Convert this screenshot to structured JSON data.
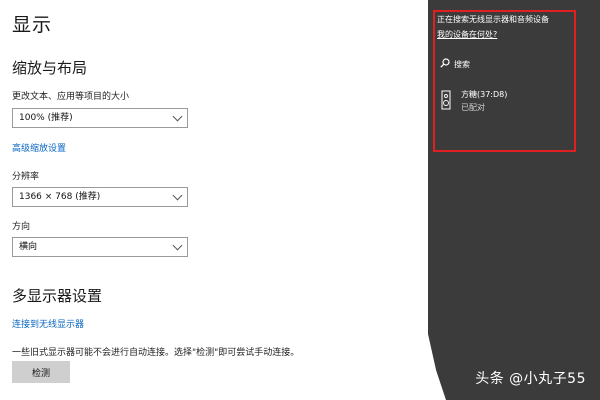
{
  "settings": {
    "title": "显示",
    "scale_layout": {
      "heading": "缩放与布局",
      "text_size_label": "更改文本、应用等项目的大小",
      "text_size_value": "100% (推荐)",
      "advanced_link": "高级缩放设置",
      "resolution_label": "分辨率",
      "resolution_value": "1366 × 768 (推荐)",
      "orientation_label": "方向",
      "orientation_value": "横向"
    },
    "multi_display": {
      "heading": "多显示器设置",
      "connect_link": "连接到无线显示器",
      "note": "一些旧式显示器可能不会进行自动连接。选择\"检测\"即可尝试手动连接。",
      "detect_button": "检测"
    }
  },
  "panel": {
    "searching_text": "正在搜索无线显示器和音频设备",
    "where_link": "我的设备在何处?",
    "search_label": "搜索",
    "device_name": "方糖(37:D8)",
    "device_status": "已配对",
    "search_icon": "magnifier-icon",
    "device_icon": "speaker-device-icon"
  },
  "watermark": "头条 @小丸子55",
  "colors": {
    "panel_bg": "#3b3b3b",
    "highlight_border": "#e02020",
    "link": "#0a66c2"
  }
}
